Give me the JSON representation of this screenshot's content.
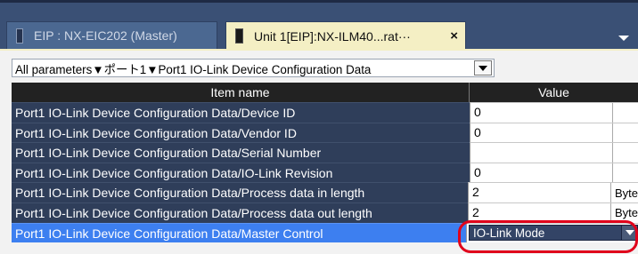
{
  "tabs": [
    {
      "label": "EIP : NX-EIC202 (Master)",
      "icon": "device-icon",
      "active": false
    },
    {
      "label": "Unit 1[EIP]:NX-ILM40...rat···",
      "icon": "device-icon",
      "active": true,
      "close_label": "×"
    }
  ],
  "breadcrumb": {
    "text": "All parameters▼ポート1▼Port1 IO-Link Device Configuration Data"
  },
  "grid": {
    "header": {
      "name": "Item name",
      "value": "Value"
    },
    "rows": [
      {
        "name": "Port1 IO-Link Device Configuration Data/Device ID",
        "value": "0",
        "unit": ""
      },
      {
        "name": "Port1 IO-Link Device Configuration Data/Vendor ID",
        "value": "0",
        "unit": ""
      },
      {
        "name": "Port1 IO-Link Device Configuration Data/Serial Number",
        "value": "",
        "unit": ""
      },
      {
        "name": "Port1 IO-Link Device Configuration Data/IO-Link Revision",
        "value": "0",
        "unit": ""
      },
      {
        "name": "Port1 IO-Link Device Configuration Data/Process data in length",
        "value": "2",
        "unit": "Byte"
      },
      {
        "name": "Port1 IO-Link Device Configuration Data/Process data out length",
        "value": "2",
        "unit": "Byte"
      },
      {
        "name": "Port1 IO-Link Device Configuration Data/Master Control",
        "value": "IO-Link Mode",
        "unit": "",
        "selected": true
      }
    ]
  },
  "colors": {
    "highlight": "#e0001b",
    "selected_row": "#3d7ff0",
    "header": "#222222",
    "tab_active": "#f4efc4"
  }
}
